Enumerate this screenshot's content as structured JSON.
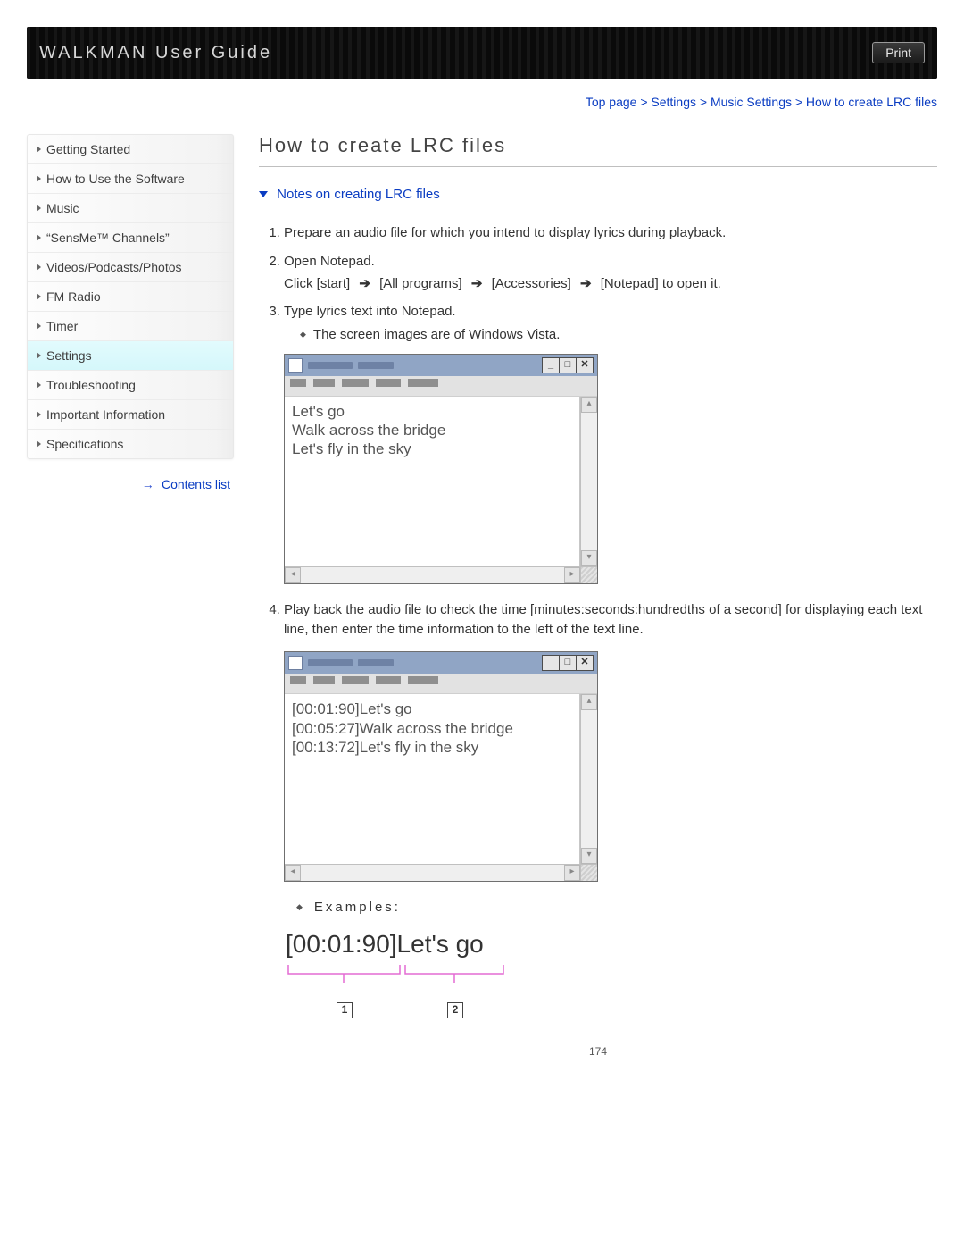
{
  "header": {
    "title": "WALKMAN User Guide",
    "print_label": "Print"
  },
  "breadcrumb": "Top page > Settings > Music Settings > How to create LRC files",
  "sidebar": {
    "items": [
      "Getting Started",
      "How to Use the Software",
      "Music",
      "“SensMe™ Channels”",
      "Videos/Podcasts/Photos",
      "FM Radio",
      "Timer",
      "Settings",
      "Troubleshooting",
      "Important Information",
      "Specifications"
    ],
    "active_index": 7,
    "contents_link": "Contents list"
  },
  "main": {
    "title": "How to create LRC files",
    "anchor": "Notes on creating LRC files",
    "steps": {
      "s1": "Prepare an audio file for which you intend to display lyrics during playback.",
      "s2": "Open Notepad.",
      "s2_sub_parts": {
        "a": "Click [start]",
        "b": "[All programs]",
        "c": "[Accessories]",
        "d": "[Notepad] to open it."
      },
      "s3": "Type lyrics text into Notepad.",
      "s3_bullet": "The screen images are of Windows Vista.",
      "s4": "Play back the audio file to check the time [minutes:seconds:hundredths of a second] for displaying each text line, then enter the time information to the left of the text line."
    },
    "notepad1_lines": [
      "Let's go",
      "Walk across the bridge",
      "Let's fly in the sky"
    ],
    "notepad2_lines": [
      "[00:01:90]Let's go",
      "[00:05:27]Walk across the bridge",
      "[00:13:72]Let's fly in the sky"
    ],
    "examples_label": "Examples:",
    "example_text": "[00:01:90]Let's go",
    "example_markers": {
      "m1": "1",
      "m2": "2"
    }
  },
  "page_number": "174"
}
